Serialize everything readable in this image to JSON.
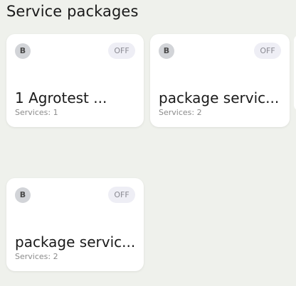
{
  "header": {
    "title": "Service packages"
  },
  "packages": [
    {
      "avatar_letter": "B",
      "toggle_label": "OFF",
      "name": "1 Agrotest ...",
      "services": "Services: 1"
    },
    {
      "avatar_letter": "B",
      "toggle_label": "OFF",
      "name": "package servic...",
      "services": "Services: 2"
    },
    {
      "avatar_letter": "B",
      "toggle_label": "OFF",
      "name": "package servic...",
      "services": "Services: 2"
    }
  ],
  "colors": {
    "background": "#eff1ec",
    "card": "#ffffff",
    "avatar": "#d2d4d8",
    "toggle_off": "#eeeef5"
  }
}
